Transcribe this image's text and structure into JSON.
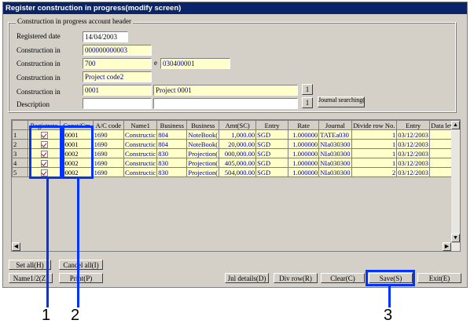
{
  "window": {
    "title": "Register construction in progress(modify screen)"
  },
  "header": {
    "group_label": "Construction in progress account header",
    "registered_date_label": "Registered date",
    "registered_date": "14/04/2003",
    "row1_label": "Construction in",
    "row1_value": "000000000003",
    "row2_label": "Construction in",
    "row2_value_a": "700",
    "row2_sep": "e",
    "row2_value_b": "030400001",
    "row3_label": "Construction in",
    "row3_value": "Project code2",
    "row4_label": "Construction in",
    "row4_code": "0001",
    "row4_name": "Project 0001",
    "row4_btn": "1",
    "desc_label": "Description",
    "desc_btn": "1",
    "journal_btn": "Journal searching(I)"
  },
  "grid": {
    "columns": [
      "",
      "Registrato",
      "Const/Cm",
      "A/C code",
      "Name1",
      "Business",
      "Business",
      "Amt(SC)",
      "Entry",
      "Rate",
      "Journal",
      "Divide row No.",
      "Entry",
      "Data level"
    ],
    "rows": [
      [
        "1",
        "00001",
        "1690",
        "Constructic",
        "804",
        "NoteBook(",
        "1,000.00",
        "SGD",
        "1.000000",
        "TATEa030",
        "1",
        "03/12/2003",
        "1"
      ],
      [
        "2",
        "00001",
        "1690",
        "Constructic",
        "804",
        "NoteBook(",
        "20,000.00",
        "SGD",
        "1.000000",
        "NIa030300",
        "1",
        "03/12/2003",
        "1"
      ],
      [
        "3",
        "00002",
        "1690",
        "Constructic",
        "830",
        "Projection(",
        "000,000.00",
        "SGD",
        "1.000000",
        "NIa030300",
        "1",
        "03/12/2003",
        "1"
      ],
      [
        "4",
        "00002",
        "1690",
        "Constructic",
        "830",
        "Projection(",
        "405,000.00",
        "SGD",
        "1.000000",
        "NIa030300",
        "1",
        "03/12/2003",
        "1"
      ],
      [
        "5",
        "00002",
        "1690",
        "Constructic",
        "830",
        "Projection(",
        "504,000.00",
        "SGD",
        "1.000000",
        "NIa030300",
        "2",
        "03/12/2003",
        "1"
      ]
    ]
  },
  "buttons": {
    "set_all": "Set all(H)",
    "cancel_all": "Cancel all(I)",
    "name12": "Name1/2(Z)",
    "print": "Print(P)",
    "jnl_details": "Jnl details(D)",
    "div_row": "Div row(R)",
    "clear": "Clear(C)",
    "save": "Save(S)",
    "exit": "Exit(E)"
  },
  "annotations": {
    "a1": "1",
    "a2": "2",
    "a3": "3",
    "color": "#0033ff"
  }
}
